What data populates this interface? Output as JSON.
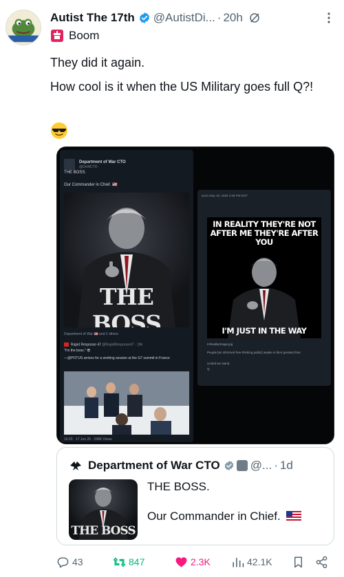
{
  "author": {
    "display_name": "Autist The 17th",
    "handle": "@AutistDi...",
    "separator": "·",
    "time": "20h",
    "avatar_label": "Autist 17th"
  },
  "reply_context": {
    "icon": "boom-icon",
    "label": "Boom"
  },
  "post": {
    "line1": "They did it again.",
    "line2": "How cool is it when the US Military goes full Q?!",
    "emoji": "sunglasses-emoji"
  },
  "media": {
    "left_card": {
      "name": "Department of War CTO",
      "handle": "@DoWCTO",
      "text1": "THE BOSS.",
      "text2": "Our Commander in Chief. 🇺🇸",
      "image_caption": "THE BOSS",
      "tagline": "Department of War 🇺🇸 and 2 others",
      "sub_author": "Rapid Response 47",
      "sub_handle": "@RapidResponse47 · 19h",
      "sub_quote": "\"I'm the boss.\" 😎",
      "sub_text": "—@POTUS arrives for a working session at the G7 summit in France",
      "footer": "16:20 · 17 Jun 26 · 248K Views"
    },
    "right_card": {
      "meta": "anon May 15, 2026 2:08 PM EDT",
      "poster_top": "IN REALITY THEY'RE NOT AFTER ME THEY'RE AFTER YOU",
      "poster_bottom": "I'M JUST IN THE WAY",
      "filename": "InRealityImage.jpg",
      "caption": "People [an informed free-thinking public] awake is their greatest fear.",
      "caption2": "United we stand.",
      "caption3": "Q"
    }
  },
  "quote": {
    "name": "Department of War CTO",
    "handle": "@...",
    "separator": "·",
    "time": "1d",
    "text1": "THE BOSS.",
    "text2": "Our Commander in Chief.",
    "thumb_caption": "THE BOSS"
  },
  "actions": {
    "reply_count": "43",
    "repost_count": "847",
    "like_count": "2.3K",
    "view_count": "42.1K"
  },
  "colors": {
    "verified": "#1d9bf0",
    "repost": "#00ba7c",
    "like": "#f91880",
    "secondary_text": "#536471",
    "border": "#cfd9de"
  }
}
